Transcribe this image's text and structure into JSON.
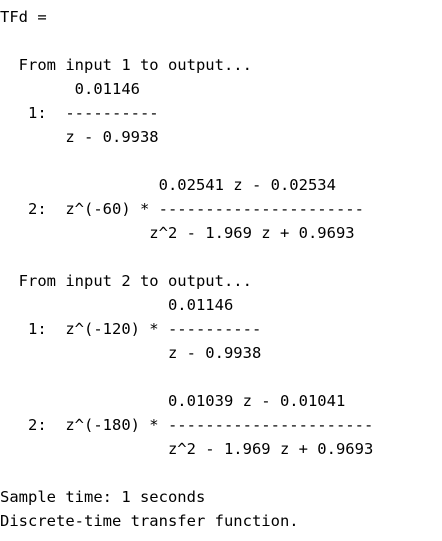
{
  "command_window": {
    "lines": [
      "TFd =",
      "",
      "  From input 1 to output...",
      "        0.01146",
      "   1:  ----------",
      "       z - 0.9938",
      "",
      "                 0.02541 z - 0.02534",
      "   2:  z^(-60) * ----------------------",
      "                z^2 - 1.969 z + 0.9693",
      "",
      "  From input 2 to output...",
      "                  0.01146",
      "   1:  z^(-120) * ----------",
      "                  z - 0.9938",
      "",
      "                  0.01039 z - 0.01041",
      "   2:  z^(-180) * ----------------------",
      "                  z^2 - 1.969 z + 0.9693",
      "",
      "Sample time: 1 seconds",
      "Discrete-time transfer function."
    ]
  }
}
